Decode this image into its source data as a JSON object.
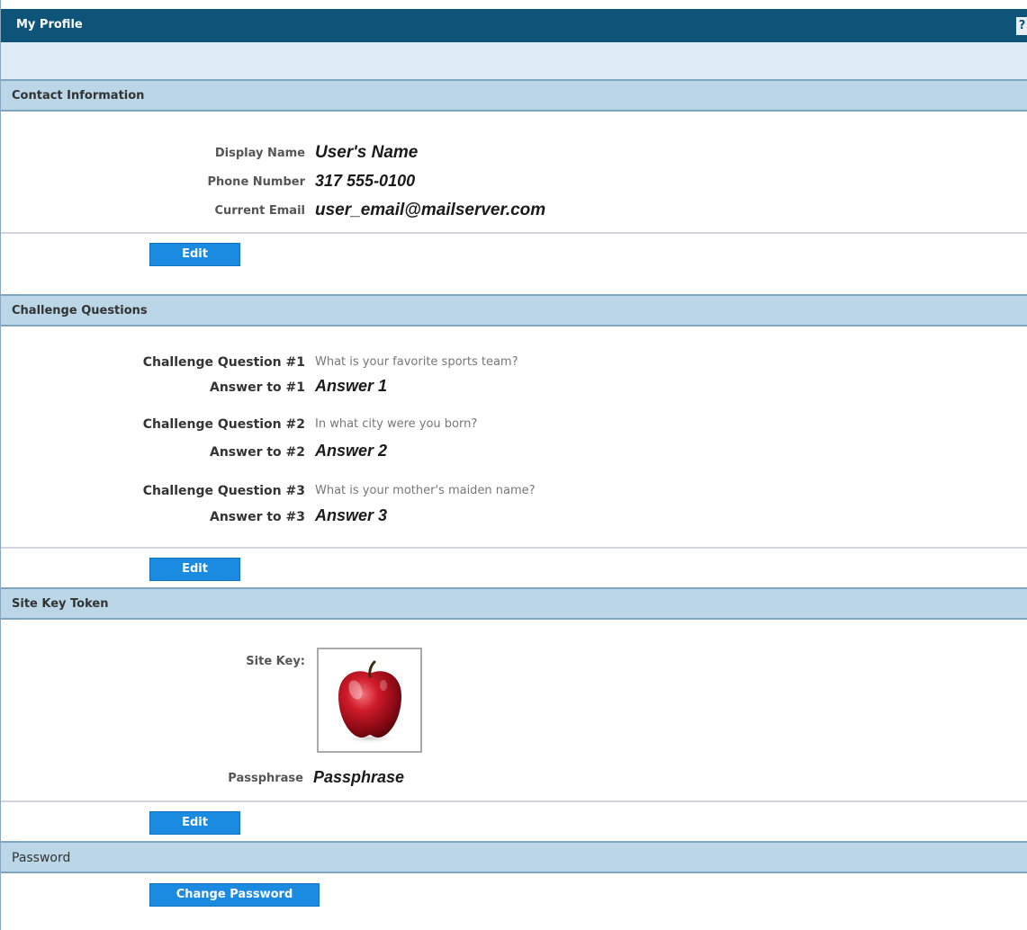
{
  "header": {
    "title": "My Profile"
  },
  "contact": {
    "section_title": "Contact Information",
    "display_name_label": "Display Name",
    "display_name_value": "User's Name",
    "phone_label": "Phone Number",
    "phone_value": "317 555-0100",
    "email_label": "Current Email",
    "email_value": "user_email@mailserver.com",
    "edit_label": "Edit"
  },
  "challenge": {
    "section_title": "Challenge Questions",
    "questions": [
      {
        "question_label": "Challenge Question #1",
        "question_text": "What is your favorite sports team?",
        "answer_label": "Answer to #1",
        "answer_value": "Answer 1"
      },
      {
        "question_label": "Challenge Question #2",
        "question_text": "In what city were you born?",
        "answer_label": "Answer to #2",
        "answer_value": "Answer 2"
      },
      {
        "question_label": "Challenge Question #3",
        "question_text": "What is your mother's maiden name?",
        "answer_label": "Answer to #3",
        "answer_value": "Answer 3"
      }
    ],
    "edit_label": "Edit"
  },
  "sitekey": {
    "section_title": "Site Key Token",
    "site_key_label": "Site Key:",
    "site_key_image": "red-apple",
    "passphrase_label": "Passphrase",
    "passphrase_value": "Passphrase",
    "edit_label": "Edit"
  },
  "password": {
    "section_title": "Password",
    "change_label": "Change Password"
  },
  "colors": {
    "header_bg": "#0e5478",
    "section_bg": "#bad6e7",
    "button_bg": "#1a8be0"
  }
}
